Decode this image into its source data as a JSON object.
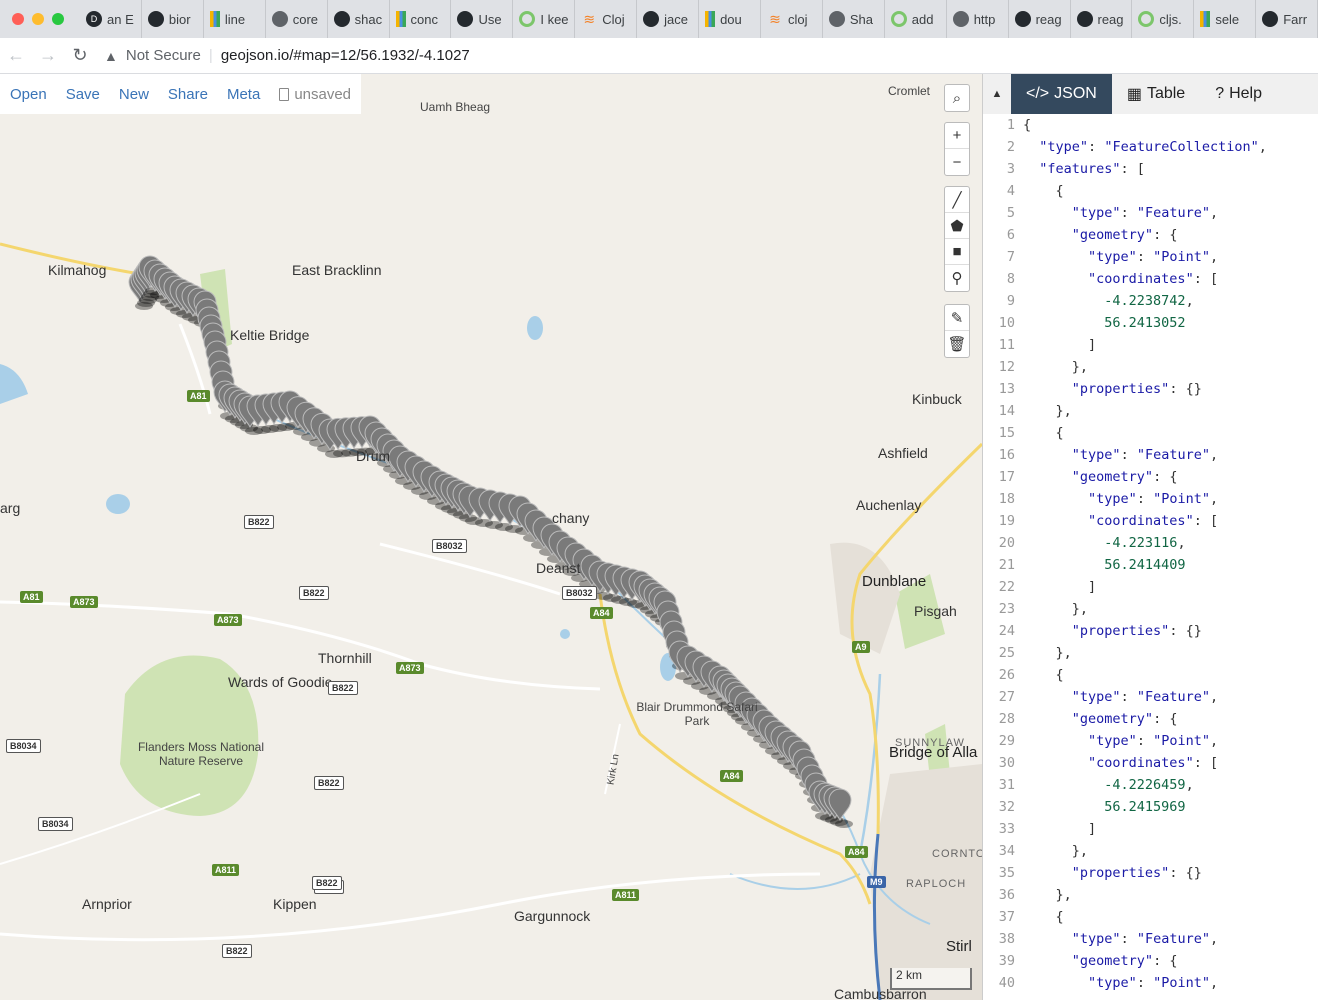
{
  "browser": {
    "tabs": [
      {
        "label": "an E",
        "icon": "dgs-icon"
      },
      {
        "label": "bior",
        "icon": "github-icon"
      },
      {
        "label": "line",
        "icon": "bars-icon"
      },
      {
        "label": "core",
        "icon": "globe-icon"
      },
      {
        "label": "shac",
        "icon": "github-icon"
      },
      {
        "label": "conc",
        "icon": "bars-icon"
      },
      {
        "label": "Use",
        "icon": "github-icon"
      },
      {
        "label": "I kee",
        "icon": "ring-icon"
      },
      {
        "label": "Cloj",
        "icon": "stackoverflow-icon"
      },
      {
        "label": "jace",
        "icon": "github-icon"
      },
      {
        "label": "dou",
        "icon": "bars-icon"
      },
      {
        "label": "cloj",
        "icon": "stackoverflow-icon"
      },
      {
        "label": "Sha",
        "icon": "globe-icon"
      },
      {
        "label": "add",
        "icon": "ring-icon"
      },
      {
        "label": "http",
        "icon": "globe-icon"
      },
      {
        "label": "reag",
        "icon": "github-icon"
      },
      {
        "label": "reag",
        "icon": "github-icon"
      },
      {
        "label": "cljs.",
        "icon": "ring-icon"
      },
      {
        "label": "sele",
        "icon": "bars-icon"
      },
      {
        "label": "Farr",
        "icon": "github-icon"
      }
    ],
    "security": "Not Secure",
    "url": "geojson.io/#map=12/56.1932/-4.1027"
  },
  "menu": {
    "open": "Open",
    "save": "Save",
    "new": "New",
    "share": "Share",
    "meta": "Meta",
    "status": "unsaved"
  },
  "map": {
    "places": [
      {
        "name": "Uamh Bheag",
        "kind": "peak"
      },
      {
        "name": "Cromlet",
        "kind": "peak"
      },
      {
        "name": "Kilmahog",
        "kind": "town"
      },
      {
        "name": "East Bracklinn",
        "kind": "town"
      },
      {
        "name": "Keltie Bridge",
        "kind": "town"
      },
      {
        "name": "Kinbuck",
        "kind": "town"
      },
      {
        "name": "Ashfield",
        "kind": "town"
      },
      {
        "name": "Auchenlay",
        "kind": "town"
      },
      {
        "name": "Dunblane",
        "kind": "big"
      },
      {
        "name": "Pisgah",
        "kind": "town"
      },
      {
        "name": "Thornhill",
        "kind": "town"
      },
      {
        "name": "Wards of Goodie",
        "kind": "town"
      },
      {
        "name": "Flanders Moss National Nature Reserve",
        "kind": "park"
      },
      {
        "name": "Blair Drummond Safari Park",
        "kind": "park"
      },
      {
        "name": "SUNNYLAW",
        "kind": "area"
      },
      {
        "name": "Bridge of Alla",
        "kind": "big"
      },
      {
        "name": "Kirk Ln",
        "kind": "street"
      },
      {
        "name": "CORNTO",
        "kind": "area"
      },
      {
        "name": "RAPLOCH",
        "kind": "area"
      },
      {
        "name": "Arnprior",
        "kind": "town"
      },
      {
        "name": "Kippen",
        "kind": "town"
      },
      {
        "name": "Gargunnock",
        "kind": "town"
      },
      {
        "name": "Stirl",
        "kind": "big"
      },
      {
        "name": "Cambusbarron",
        "kind": "town"
      },
      {
        "name": "Drum",
        "kind": "town"
      },
      {
        "name": "chany",
        "kind": "town"
      },
      {
        "name": "Deanst",
        "kind": "town"
      },
      {
        "name": "arg",
        "kind": "town"
      }
    ],
    "roads": [
      "A81",
      "B822",
      "B8032",
      "B822",
      "A81",
      "A873",
      "A873",
      "A873",
      "B822",
      "B822",
      "B8034",
      "B8034",
      "B822",
      "A84",
      "B8032",
      "A84",
      "A9",
      "A84",
      "M9",
      "A811",
      "A811",
      "B822",
      "B822"
    ],
    "scale": "2 km"
  },
  "pane": {
    "tabs": [
      "JSON",
      "Table",
      "Help"
    ],
    "code_lines": [
      "{",
      "  \"type\": \"FeatureCollection\",",
      "  \"features\": [",
      "    {",
      "      \"type\": \"Feature\",",
      "      \"geometry\": {",
      "        \"type\": \"Point\",",
      "        \"coordinates\": [",
      "          -4.2238742,",
      "          56.2413052",
      "        ]",
      "      },",
      "      \"properties\": {}",
      "    },",
      "    {",
      "      \"type\": \"Feature\",",
      "      \"geometry\": {",
      "        \"type\": \"Point\",",
      "        \"coordinates\": [",
      "          -4.223116,",
      "          56.2414409",
      "        ]",
      "      },",
      "      \"properties\": {}",
      "    },",
      "    {",
      "      \"type\": \"Feature\",",
      "      \"geometry\": {",
      "        \"type\": \"Point\",",
      "        \"coordinates\": [",
      "          -4.2226459,",
      "          56.2415969",
      "        ]",
      "      },",
      "      \"properties\": {}",
      "    },",
      "    {",
      "      \"type\": \"Feature\",",
      "      \"geometry\": {",
      "        \"type\": \"Point\","
    ]
  },
  "colors": {
    "menu_link": "#3a74b7",
    "active_tab": "#34495e",
    "marker": "#7a7a7a",
    "a_road": "#5a8a2c"
  }
}
